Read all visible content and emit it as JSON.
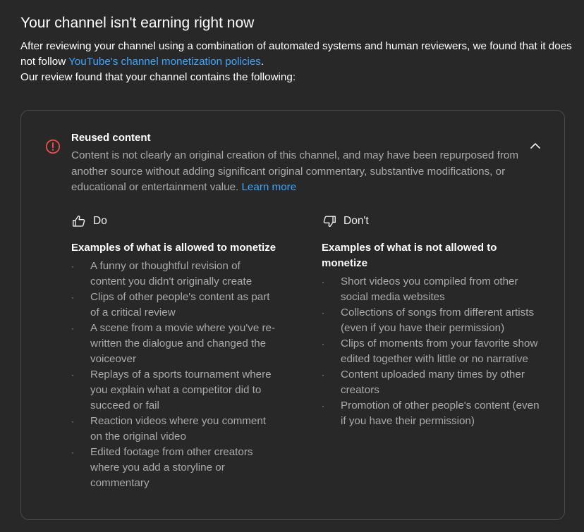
{
  "header": {
    "title": "Your channel isn't earning right now",
    "intro_part1": "After reviewing your channel using a combination of automated systems and human reviewers, we found that it does not follow ",
    "intro_link": "YouTube's channel monetization policies",
    "intro_part2": ".",
    "intro_line2": "Our review found that your channel contains the following:"
  },
  "card": {
    "alert_icon": "error-circle-icon",
    "title": "Reused content",
    "description": "Content is not clearly an original creation of this channel, and may have been repurposed from another source without adding significant original commentary, substantive modifications, or educational or entertainment value.",
    "learn_more": "Learn more",
    "collapse_icon": "chevron-up-icon",
    "do": {
      "icon": "thumbs-up-icon",
      "label": "Do",
      "subtitle": "Examples of what is allowed to monetize",
      "items": [
        "A funny or thoughtful revision of content you didn't originally create",
        "Clips of other people's content as part of a critical review",
        "A scene from a movie where you've re-written the dialogue and changed the voiceover",
        "Replays of a sports tournament where you explain what a competitor did to succeed or fail",
        "Reaction videos where you comment on the original video",
        "Edited footage from other creators where you add a storyline or commentary"
      ]
    },
    "dont": {
      "icon": "thumbs-down-icon",
      "label": "Don't",
      "subtitle": "Examples of what is not allowed to monetize",
      "items": [
        "Short videos you compiled from other social media websites",
        "Collections of songs from different artists (even if you have their permission)",
        "Clips of moments from your favorite show edited together with little or no narrative",
        "Content uploaded many times by other creators",
        "Promotion of other people's content (even if you have their permission)"
      ]
    }
  },
  "colors": {
    "background": "#282828",
    "link": "#3ea6ff",
    "alert": "#ff4e45",
    "secondary_text": "#aaaaaa",
    "border": "#4a4a4a"
  },
  "bullet": "·"
}
